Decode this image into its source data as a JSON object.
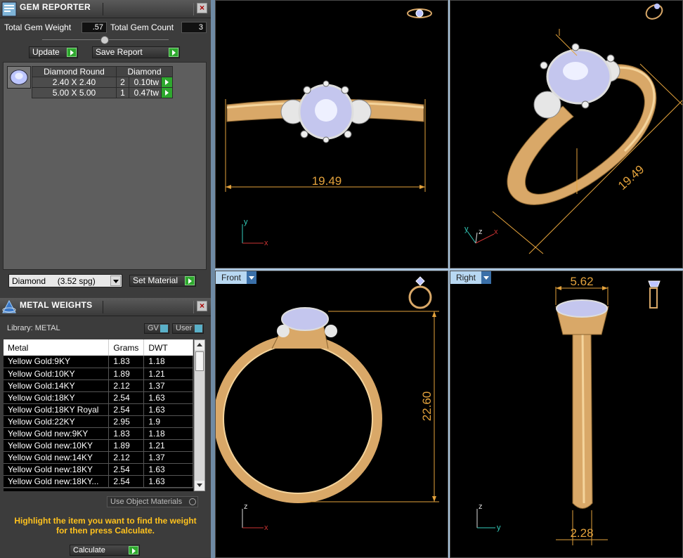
{
  "gem_reporter": {
    "title": "GEM REPORTER",
    "total_gem_weight_label": "Total Gem Weight",
    "total_gem_weight_value": ".57",
    "total_gem_count_label": "Total Gem Count",
    "total_gem_count_value": "3",
    "update_label": "Update",
    "save_report_label": "Save Report",
    "table_header_shape": "Diamond Round",
    "table_header_type": "Diamond",
    "rows": [
      {
        "size": "2.40 X 2.40",
        "count": "2",
        "tw": "0.10tw"
      },
      {
        "size": "5.00 X 5.00",
        "count": "1",
        "tw": "0.47tw"
      }
    ],
    "material_select": "Diamond     (3.52 spg)",
    "set_material_label": "Set Material"
  },
  "metal_weights": {
    "title": "METAL WEIGHTS",
    "library_label": "Library: METAL",
    "gv_label": "GV",
    "user_label": "User",
    "columns": [
      "Metal",
      "Grams",
      "DWT"
    ],
    "rows": [
      {
        "metal": "Yellow Gold:9KY",
        "grams": "1.83",
        "dwt": "1.18"
      },
      {
        "metal": "Yellow Gold:10KY",
        "grams": "1.89",
        "dwt": "1.21"
      },
      {
        "metal": "Yellow Gold:14KY",
        "grams": "2.12",
        "dwt": "1.37"
      },
      {
        "metal": "Yellow Gold:18KY",
        "grams": "2.54",
        "dwt": "1.63"
      },
      {
        "metal": "Yellow Gold:18KY Royal",
        "grams": "2.54",
        "dwt": "1.63"
      },
      {
        "metal": "Yellow Gold:22KY",
        "grams": "2.95",
        "dwt": "1.9"
      },
      {
        "metal": "Yellow Gold new:9KY",
        "grams": "1.83",
        "dwt": "1.18"
      },
      {
        "metal": "Yellow Gold new:10KY",
        "grams": "1.89",
        "dwt": "1.21"
      },
      {
        "metal": "Yellow Gold new:14KY",
        "grams": "2.12",
        "dwt": "1.37"
      },
      {
        "metal": "Yellow Gold new:18KY",
        "grams": "2.54",
        "dwt": "1.63"
      },
      {
        "metal": "Yellow Gold new:18KY...",
        "grams": "2.54",
        "dwt": "1.63"
      }
    ],
    "use_object_materials_label": "Use Object Materials",
    "hint_line1": "Highlight the item you want to find the weight",
    "hint_line2": "for then press Calculate.",
    "calculate_label": "Calculate"
  },
  "viewports": {
    "top_dimension": "19.49",
    "perspective_dimension": "19.49",
    "front_label": "Front",
    "front_dimension": "22.60",
    "right_label": "Right",
    "right_width_dimension": "5.62",
    "right_bottom_dimension": "2.28",
    "axis_x": "x",
    "axis_y": "y",
    "axis_z": "z"
  },
  "colors": {
    "panel_bg": "#3c3c3c",
    "viewport_bg": "#000000",
    "gold": "#d9a868",
    "dimension": "#e3a23c",
    "hint_text": "#ffc21e",
    "viewport_label": "#b8d8f2"
  }
}
